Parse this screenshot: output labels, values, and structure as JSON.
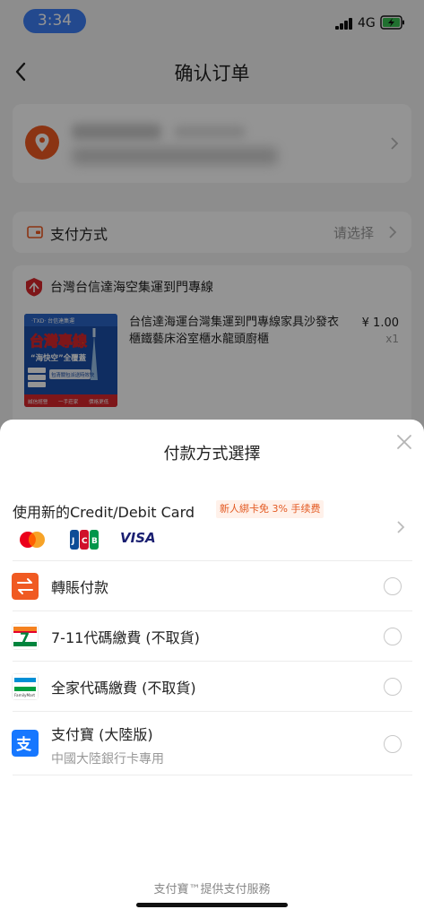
{
  "status_bar": {
    "time": "3:34",
    "network": "4G"
  },
  "nav": {
    "title": "确认订单"
  },
  "payment_row": {
    "label": "支付方式",
    "value": "请选择"
  },
  "order": {
    "shop_name": "台灣台信達海空集運到門專線",
    "product": {
      "title": "台信達海運台灣集運到門專線家具沙發衣櫃鐵藝床浴室櫃水龍頭廚櫃",
      "price": "¥ 1.00",
      "quantity": "x1",
      "image_text": {
        "brand": "·TXD· 台信達集運",
        "headline": "台灣專線",
        "slogan": "“海快空”全覆蓋",
        "tags": [
          "包清關",
          "包派送",
          "時效快"
        ],
        "bottom": [
          "誠信經營",
          "一手莊家",
          "價格更低"
        ]
      }
    }
  },
  "sheet": {
    "title": "付款方式選擇",
    "card_option": {
      "title": "使用新的Credit/Debit Card",
      "promo": "新人綁卡免 3% 手续费",
      "brands": [
        "mastercard",
        "JCB",
        "VISA"
      ]
    },
    "methods": [
      {
        "label": "轉賬付款",
        "icon": "transfer-icon",
        "sub": ""
      },
      {
        "label": "7-11代碼繳費 (不取貨)",
        "icon": "seven-eleven-icon",
        "sub": ""
      },
      {
        "label": "全家代碼繳費 (不取貨)",
        "icon": "familymart-icon",
        "sub": "",
        "icon_text": "FamilyMart"
      },
      {
        "label": "支付寶 (大陸版)",
        "icon": "alipay-icon",
        "sub": "中國大陸銀行卡專用"
      }
    ],
    "footer": "支付寶™提供支付服務"
  },
  "colors": {
    "time_pill": "#3d7ef4",
    "promo_text": "#e35a22",
    "transfer": "#f05a22",
    "alipay": "#1677ff"
  }
}
